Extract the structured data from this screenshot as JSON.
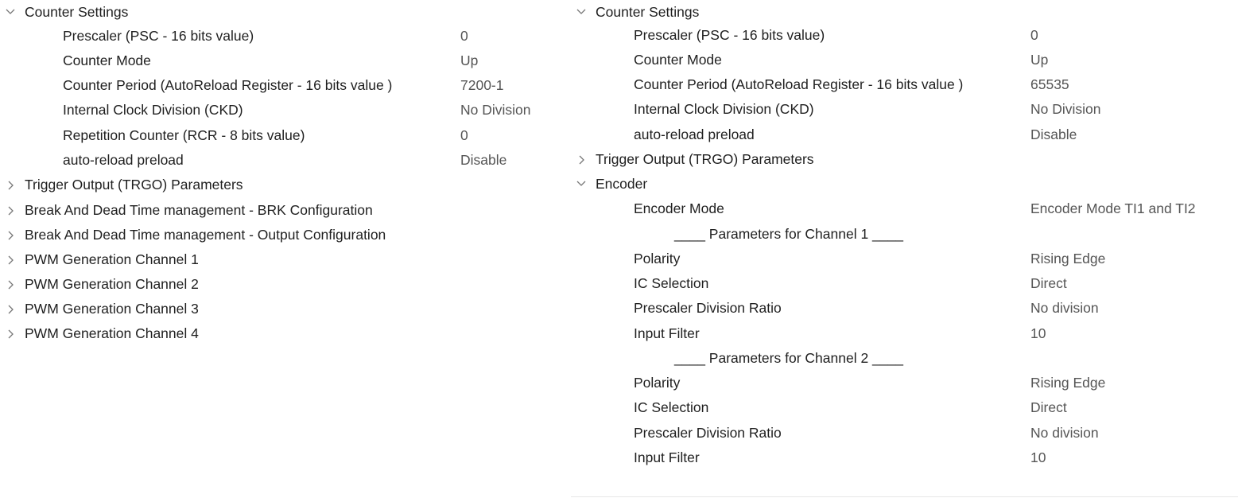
{
  "left_panel": {
    "counter_settings": {
      "label": "Counter Settings",
      "expanded": true,
      "params": [
        {
          "label": "Prescaler (PSC - 16 bits value)",
          "value": "0"
        },
        {
          "label": "Counter Mode",
          "value": "Up"
        },
        {
          "label": "Counter Period (AutoReload Register - 16 bits value )",
          "value": "7200-1"
        },
        {
          "label": "Internal Clock Division (CKD)",
          "value": "No Division"
        },
        {
          "label": "Repetition Counter (RCR - 8 bits value)",
          "value": "0"
        },
        {
          "label": "auto-reload preload",
          "value": "Disable"
        }
      ]
    },
    "collapsed_groups": [
      "Trigger Output (TRGO) Parameters",
      "Break And Dead Time management - BRK Configuration",
      "Break And Dead Time management - Output Configuration",
      "PWM Generation Channel 1",
      "PWM Generation Channel 2",
      "PWM Generation Channel 3",
      "PWM Generation Channel 4"
    ]
  },
  "right_panel": {
    "counter_settings": {
      "label": "Counter Settings",
      "expanded": true,
      "params": [
        {
          "label": "Prescaler (PSC - 16 bits value)",
          "value": "0"
        },
        {
          "label": "Counter Mode",
          "value": "Up"
        },
        {
          "label": "Counter Period (AutoReload Register - 16 bits value )",
          "value": "65535"
        },
        {
          "label": "Internal Clock Division (CKD)",
          "value": "No Division"
        },
        {
          "label": "auto-reload preload",
          "value": "Disable"
        }
      ]
    },
    "trgo": {
      "label": "Trigger Output (TRGO) Parameters",
      "expanded": false
    },
    "encoder": {
      "label": "Encoder",
      "expanded": true,
      "mode": {
        "label": "Encoder Mode",
        "value": "Encoder Mode TI1 and TI2"
      },
      "channel1": {
        "heading": "____ Parameters for Channel 1 ____",
        "params": [
          {
            "label": "Polarity",
            "value": "Rising Edge"
          },
          {
            "label": "IC Selection",
            "value": "Direct"
          },
          {
            "label": "Prescaler Division Ratio",
            "value": "No division"
          },
          {
            "label": "Input Filter",
            "value": "10"
          }
        ]
      },
      "channel2": {
        "heading": "____ Parameters for Channel 2 ____",
        "params": [
          {
            "label": "Polarity",
            "value": "Rising Edge"
          },
          {
            "label": "IC Selection",
            "value": "Direct"
          },
          {
            "label": "Prescaler Division Ratio",
            "value": "No division"
          },
          {
            "label": "Input Filter",
            "value": "10"
          }
        ]
      }
    }
  },
  "icons": {
    "expanded": "chevron-down-icon",
    "collapsed": "chevron-right-icon"
  },
  "colors": {
    "text": "#1f1f1f",
    "value_text": "#555555",
    "chevron": "#777777",
    "background": "#ffffff"
  }
}
